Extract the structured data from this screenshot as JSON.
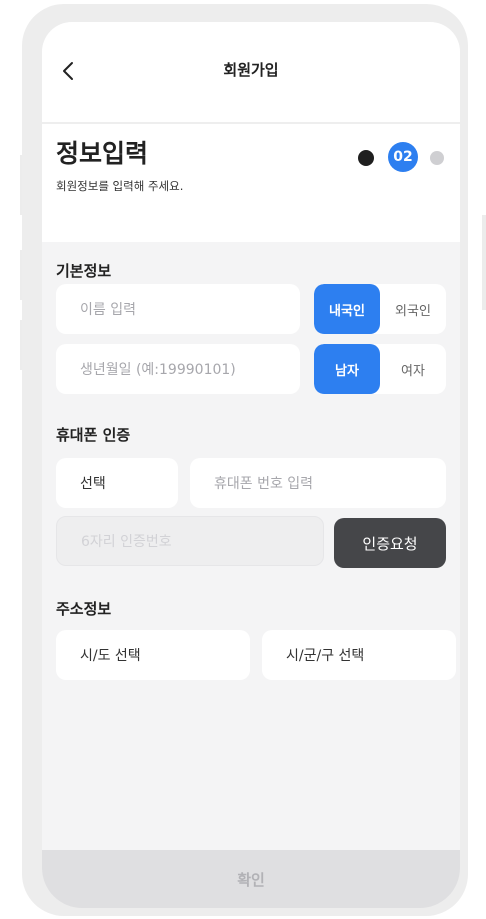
{
  "nav": {
    "back_icon": "chevron-left-icon",
    "title": "회원가입"
  },
  "header": {
    "title": "정보입력",
    "subtitle": "회원정보를 입력해 주세요.",
    "step_current": "02"
  },
  "basic_info": {
    "title": "기본정보",
    "name_placeholder": "이름 입력",
    "nationality": {
      "options": [
        "내국인",
        "외국인"
      ],
      "selected": "내국인"
    },
    "birth_placeholder": "생년월일 (예:19990101)",
    "gender": {
      "options": [
        "남자",
        "여자"
      ],
      "selected": "남자"
    }
  },
  "phone_auth": {
    "title": "휴대폰 인증",
    "carrier_value": "선택",
    "phone_placeholder": "휴대폰 번호 입력",
    "code_placeholder": "6자리 인증번호",
    "request_button": "인증요청"
  },
  "address": {
    "title": "주소정보",
    "sido_value": "시/도 선택",
    "sigungu_value": "시/군/구 선택"
  },
  "confirm_button": "확인",
  "colors": {
    "accent": "#2d7ff0",
    "dark_button": "#454649",
    "background": "#f4f4f5"
  }
}
